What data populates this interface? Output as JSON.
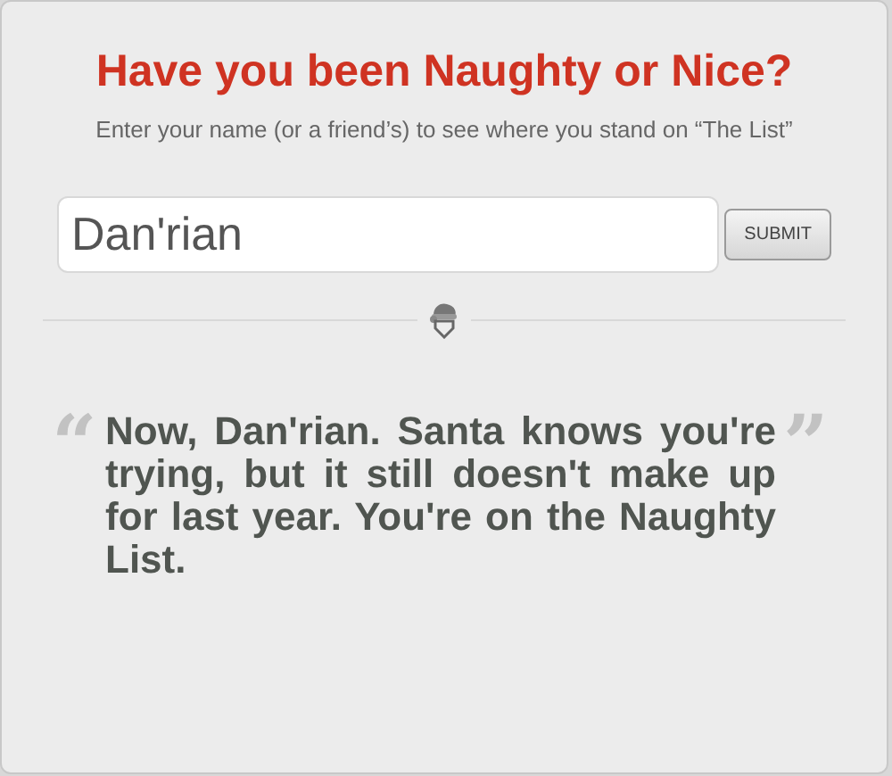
{
  "title": "Have you been Naughty or Nice?",
  "subtitle": "Enter your name (or a friend’s) to see where you stand on “The List”",
  "name_field": {
    "value": "Dan'rian"
  },
  "submit_button": "SUBMIT",
  "result": {
    "open_mark": "“",
    "text": "Now, Dan'rian. Santa knows you're trying, but it still doesn't make up for last year. You're on the Naughty List.",
    "close_mark": "”"
  }
}
